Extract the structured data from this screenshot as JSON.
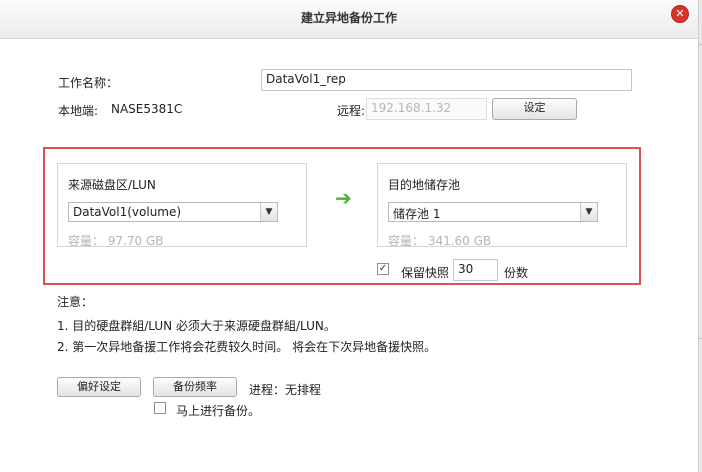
{
  "dialog": {
    "title": "建立异地备份工作",
    "close_glyph": "✕"
  },
  "form": {
    "job_name_label": "工作名称：",
    "job_name_value": "DataVol1_rep",
    "local_label": "本地端:",
    "local_value": "NASE5381C",
    "remote_label": "远程:",
    "remote_placeholder": "192.168.1.32",
    "settings_button": "设定"
  },
  "source": {
    "header": "来源磁盘区/LUN",
    "selected": "DataVol1(volume)",
    "capacity": "容量： 97.70 GB"
  },
  "arrow_glyph": "➔",
  "destination": {
    "header": "目的地储存池",
    "selected": "储存池 1",
    "capacity": "容量： 341.60 GB",
    "keep_snapshot_label": "保留快照",
    "keep_snapshot_checked": true,
    "snapshot_count": "30",
    "copies_label": "份数"
  },
  "notes": {
    "title": "注意：",
    "line1": "1. 目的硬盘群組/LUN 必须大于来源硬盘群組/LUN。",
    "line2": "2. 第一次异地备援工作将会花费较久时间。 将会在下次异地备援快照。"
  },
  "footer": {
    "preferences_button": "偏好设定",
    "frequency_button": "备份频率",
    "progress_label": "进程：无排程",
    "backup_now_label": "马上进行备份。",
    "backup_now_checked": false
  },
  "colors": {
    "highlight_frame": "#d9534f",
    "arrow": "#4caf3a",
    "close": "#d9342b"
  }
}
